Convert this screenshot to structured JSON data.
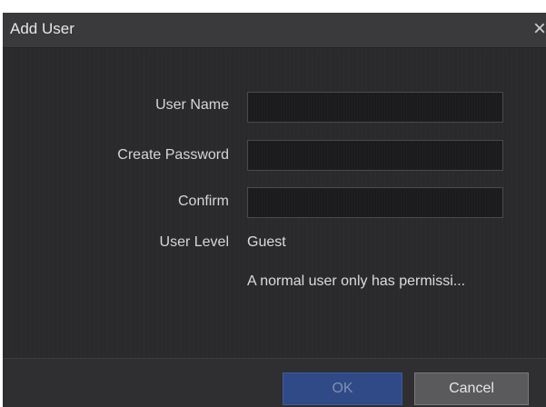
{
  "dialog": {
    "title": "Add User",
    "close_glyph": "×"
  },
  "form": {
    "user_name_label": "User Name",
    "user_name_value": "",
    "create_password_label": "Create Password",
    "create_password_value": "",
    "confirm_label": "Confirm",
    "confirm_value": "",
    "user_level_label": "User Level",
    "user_level_value": "Guest",
    "user_level_description": "A normal user only has permissi..."
  },
  "buttons": {
    "ok_label": "OK",
    "cancel_label": "Cancel"
  },
  "colors": {
    "dialog_bg": "#2c2c2e",
    "ok_button": "#2f4a86",
    "cancel_button": "#5a5a5c"
  },
  "icons": {
    "close": "close-icon"
  }
}
